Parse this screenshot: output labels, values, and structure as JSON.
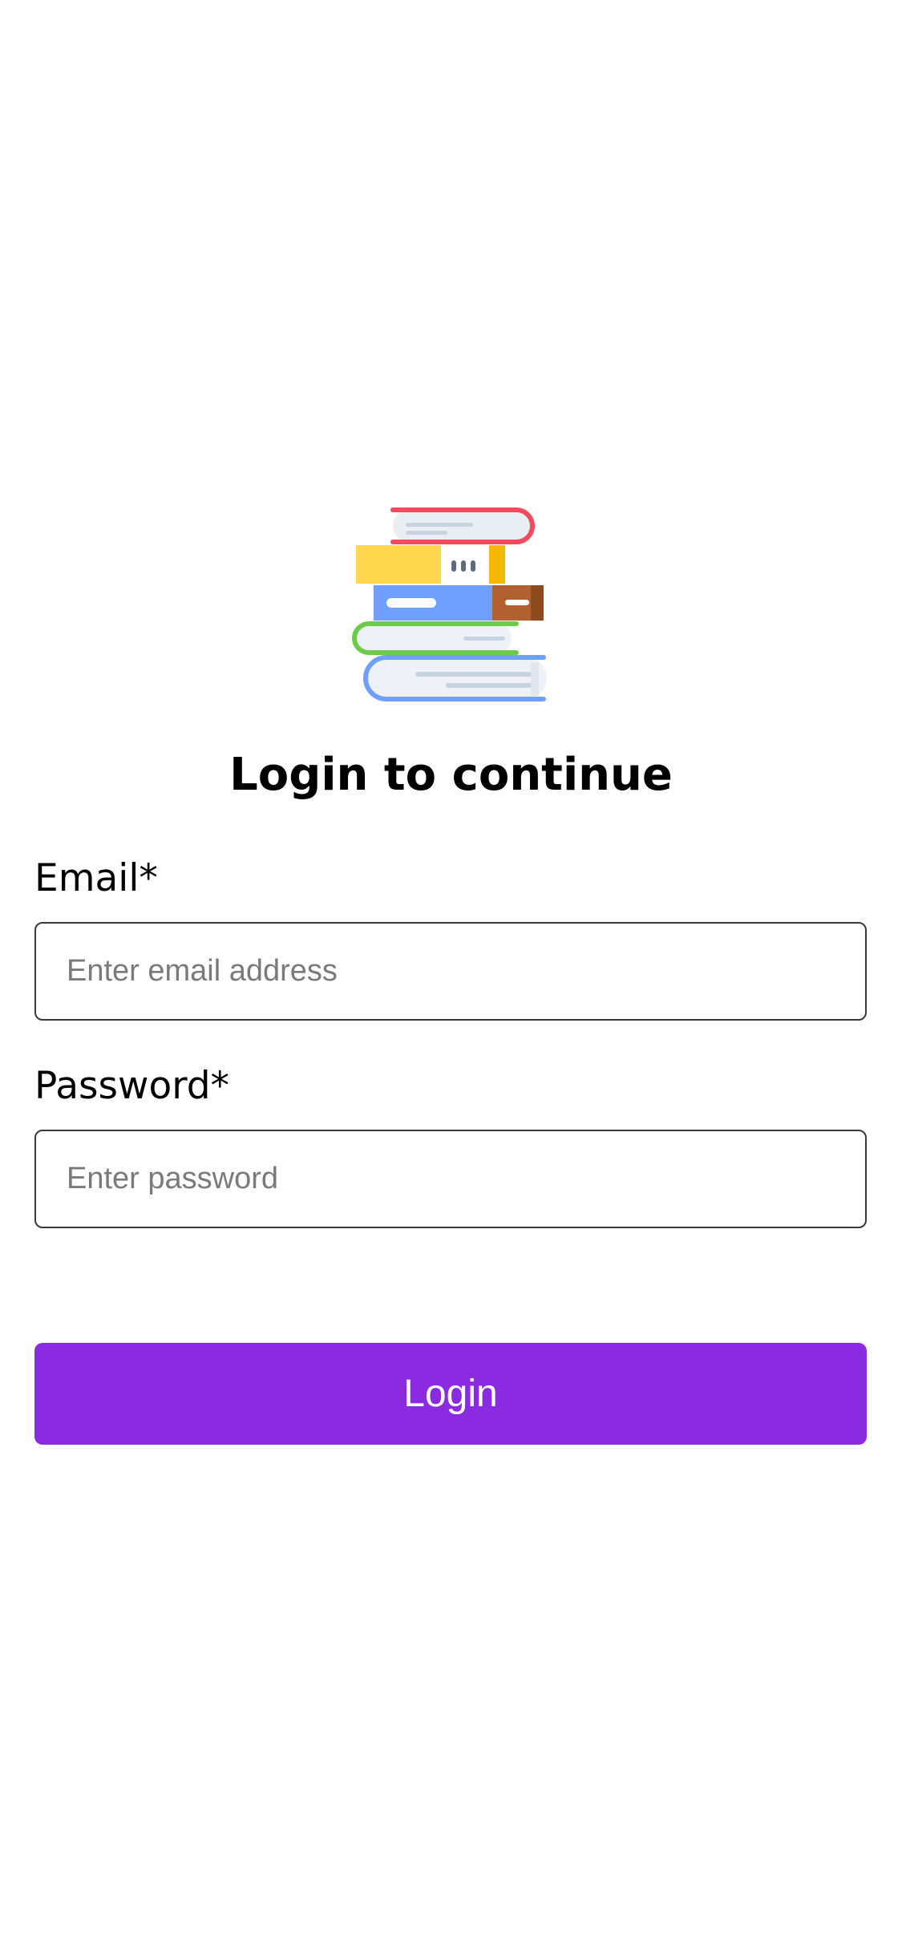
{
  "app": {
    "logo_icon": "stacked-books-icon",
    "accent_color": "#8a2be2"
  },
  "login": {
    "title": "Login to continue",
    "email": {
      "label": "Email*",
      "placeholder": "Enter email address",
      "value": ""
    },
    "password": {
      "label": "Password*",
      "placeholder": "Enter password",
      "value": ""
    },
    "submit_label": "Login"
  }
}
